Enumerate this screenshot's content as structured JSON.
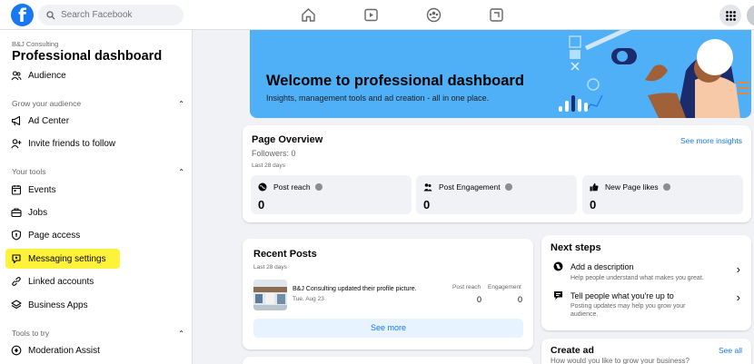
{
  "topbar": {
    "logo": "f",
    "search_placeholder": "Search Facebook",
    "nav_icons": [
      "home-icon",
      "watch-icon",
      "groups-icon",
      "gaming-icon"
    ],
    "menu_icon": "menu-grid-icon"
  },
  "sidebar": {
    "page_name": "B&J Consulting",
    "title": "Professional dashboard",
    "audience": "Audience",
    "section_grow": "Grow your audience",
    "ad_center": "Ad Center",
    "invite": "Invite friends to follow",
    "section_tools": "Your tools",
    "events": "Events",
    "jobs": "Jobs",
    "page_access": "Page access",
    "messaging": "Messaging settings",
    "linked": "Linked accounts",
    "business_apps": "Business Apps",
    "section_try": "Tools to try",
    "moderation": "Moderation Assist"
  },
  "banner": {
    "title": "Welcome to professional dashboard",
    "subtitle": "Insights, management tools and ad creation - all in one place."
  },
  "overview": {
    "title": "Page Overview",
    "followers": "Followers: 0",
    "period": "Last 28 days",
    "link": "See more insights",
    "metrics": [
      {
        "label": "Post reach",
        "value": "0"
      },
      {
        "label": "Post Engagement",
        "value": "0"
      },
      {
        "label": "New Page likes",
        "value": "0"
      }
    ]
  },
  "recent_posts": {
    "title": "Recent Posts",
    "period": "Last 28 days",
    "post_text": "B&J Consulting updated their profile picture.",
    "post_date": "Tue, Aug 23",
    "col_reach": "Post reach",
    "col_engagement": "Engagement",
    "reach_value": "0",
    "engagement_value": "0",
    "see_more": "See more"
  },
  "next_steps": {
    "title": "Next steps",
    "items": [
      {
        "title": "Add a description",
        "desc": "Help people understand what makes you great."
      },
      {
        "title": "Tell people what you're up to",
        "desc": "Posting updates may help you grow your audience."
      }
    ]
  },
  "create_ad": {
    "title": "Create ad",
    "link": "See all",
    "desc": "How would you like to grow your business?"
  },
  "colors": {
    "brand": "#1877f2",
    "banner": "#4fb0f7",
    "highlight": "#fff23a"
  }
}
